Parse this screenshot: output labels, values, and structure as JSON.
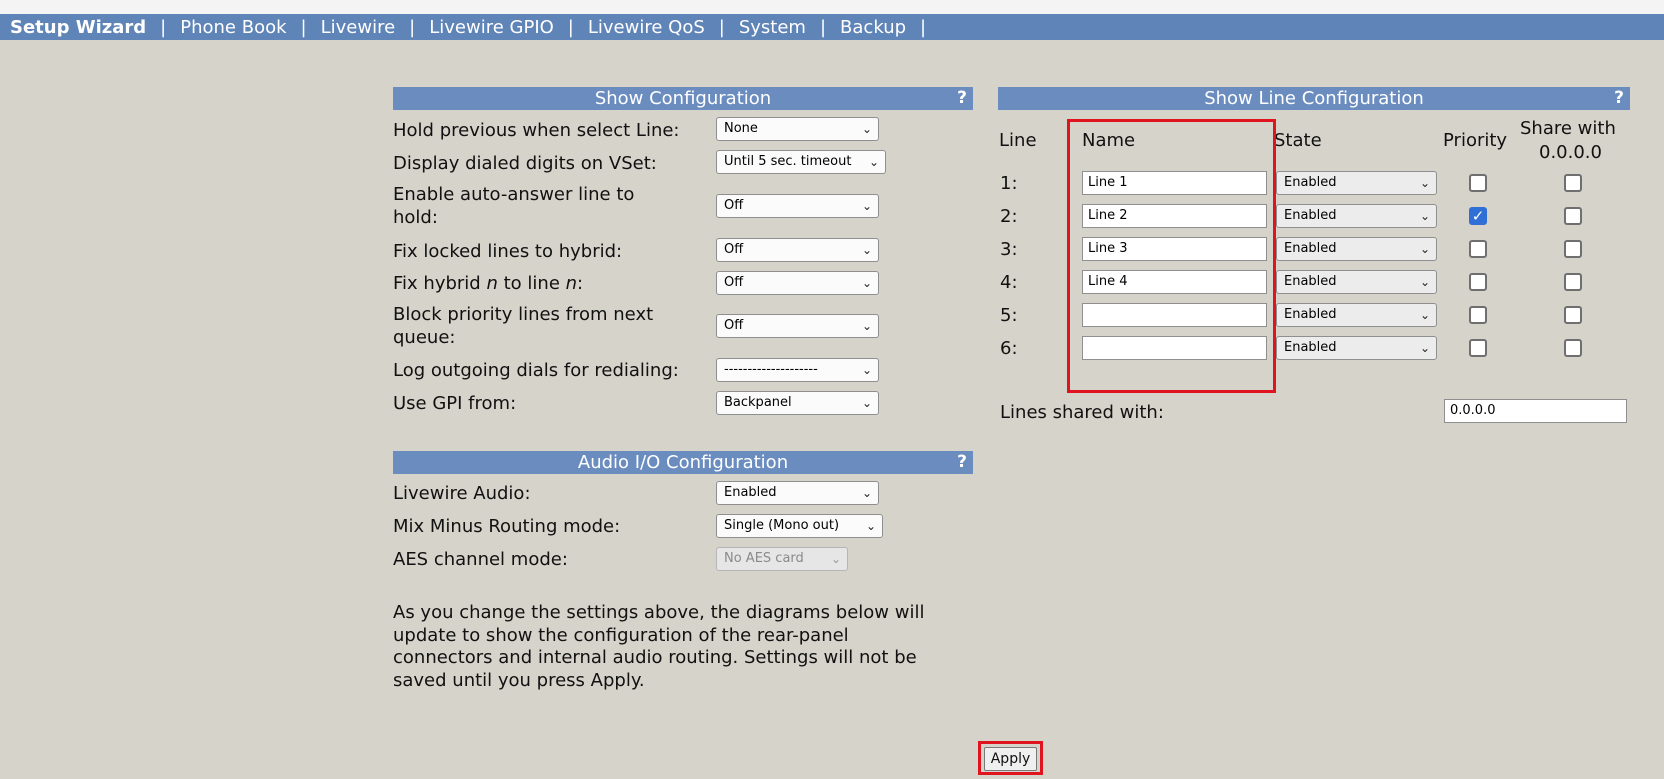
{
  "nav": {
    "items": [
      "Setup Wizard",
      "Phone Book",
      "Livewire",
      "Livewire GPIO",
      "Livewire QoS",
      "System",
      "Backup"
    ],
    "separator": "|"
  },
  "show_config": {
    "title": "Show Configuration",
    "help": "?",
    "rows": [
      {
        "label": "Hold previous when select Line:",
        "value": "None"
      },
      {
        "label": "Display dialed digits on VSet:",
        "value": "Until 5 sec. timeout"
      },
      {
        "label": "Enable auto-answer line to hold:",
        "value": "Off"
      },
      {
        "label": "Fix locked lines to hybrid:",
        "value": "Off"
      },
      {
        "label_pre": "Fix hybrid ",
        "label_n1": "n",
        "label_mid": " to line ",
        "label_n2": "n",
        "label_post": ":",
        "value": "Off"
      },
      {
        "label": "Block priority lines from next queue:",
        "value": "Off"
      },
      {
        "label": "Log outgoing dials for redialing:",
        "value": "--------------------"
      },
      {
        "label": "Use GPI from:",
        "value": "Backpanel"
      }
    ]
  },
  "audio_config": {
    "title": "Audio I/O Configuration",
    "help": "?",
    "rows": [
      {
        "label": "Livewire Audio:",
        "value": "Enabled"
      },
      {
        "label": "Mix Minus Routing mode:",
        "value": "Single (Mono out)"
      },
      {
        "label": "AES channel mode:",
        "value": "No AES card"
      }
    ],
    "note": "As you change the settings above, the diagrams below will update to show the configuration of the rear-panel connectors and internal audio routing. Settings will not be saved until you press Apply."
  },
  "line_config": {
    "title": "Show Line Configuration",
    "help": "?",
    "headers": {
      "line": "Line",
      "name": "Name",
      "state": "State",
      "priority": "Priority",
      "share": "Share with",
      "share_ip": "0.0.0.0"
    },
    "lines": [
      {
        "num": "1:",
        "name": "Line 1",
        "state": "Enabled",
        "priority": false,
        "share": false
      },
      {
        "num": "2:",
        "name": "Line 2",
        "state": "Enabled",
        "priority": true,
        "share": false
      },
      {
        "num": "3:",
        "name": "Line 3",
        "state": "Enabled",
        "priority": false,
        "share": false
      },
      {
        "num": "4:",
        "name": "Line 4",
        "state": "Enabled",
        "priority": false,
        "share": false
      },
      {
        "num": "5:",
        "name": "",
        "state": "Enabled",
        "priority": false,
        "share": false
      },
      {
        "num": "6:",
        "name": "",
        "state": "Enabled",
        "priority": false,
        "share": false
      }
    ],
    "shared_label": "Lines shared with:",
    "shared_value": "0.0.0.0"
  },
  "apply_label": "Apply",
  "chevron": "⌄",
  "checkmark": "✓",
  "highlight_color": "#e0141e"
}
